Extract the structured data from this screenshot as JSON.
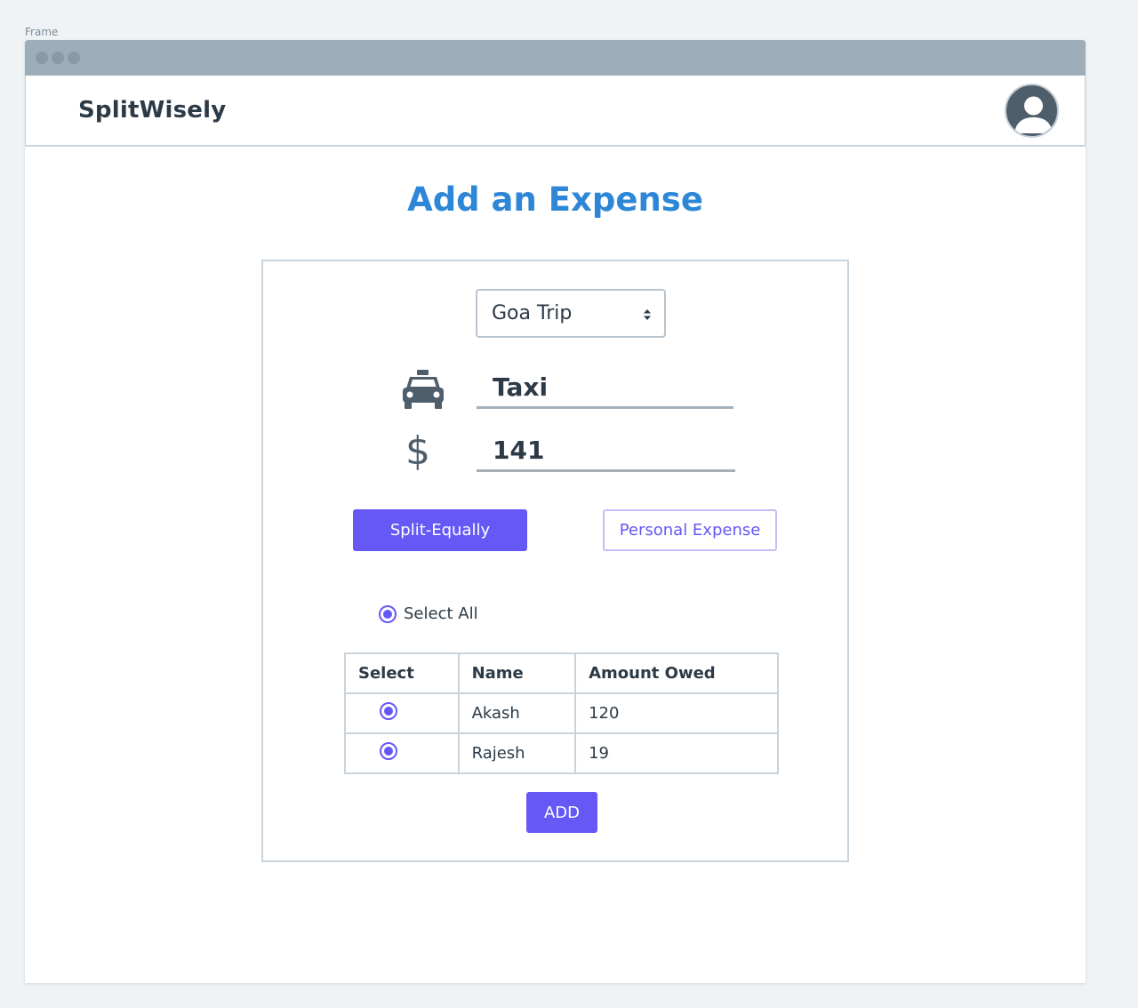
{
  "frame_label": "Frame",
  "navbar": {
    "brand": "SplitWisely",
    "avatar_icon": "user-avatar-icon"
  },
  "page": {
    "title": "Add an Expense"
  },
  "form": {
    "group_select": {
      "value": "Goa Trip"
    },
    "description": {
      "icon": "taxi-icon",
      "value": "Taxi"
    },
    "amount": {
      "icon": "dollar-icon",
      "symbol": "$",
      "value": "141"
    },
    "split_equally_label": "Split-Equally",
    "personal_expense_label": "Personal Expense",
    "select_all_label": "Select All",
    "table": {
      "headers": [
        "Select",
        "Name",
        "Amount Owed"
      ],
      "rows": [
        {
          "name": "Akash",
          "amount": "120",
          "selected": true
        },
        {
          "name": "Rajesh",
          "amount": "19",
          "selected": true
        }
      ]
    },
    "add_label": "ADD"
  },
  "colors": {
    "accent": "#6558f5",
    "title": "#2e87d6",
    "text": "#2c3a47",
    "border": "#c9d3db"
  }
}
